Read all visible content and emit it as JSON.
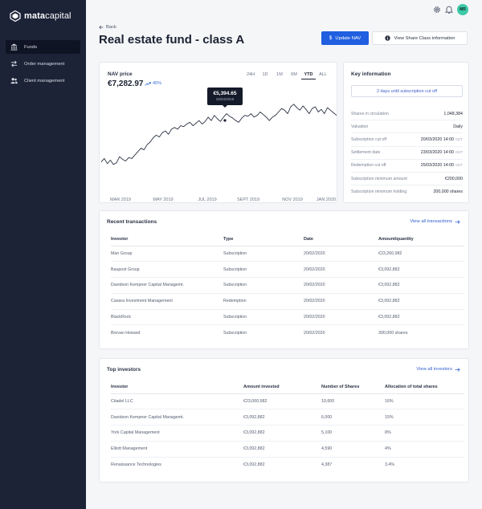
{
  "app": {
    "logo_bold": "mata",
    "logo_light": "capital"
  },
  "sidebar": {
    "items": [
      {
        "label": "Funds",
        "icon": "bank-icon",
        "active": true
      },
      {
        "label": "Order management",
        "icon": "transfer-icon",
        "active": false
      },
      {
        "label": "Client management",
        "icon": "users-icon",
        "active": false
      }
    ]
  },
  "topbar": {
    "icons": [
      "settings-icon",
      "bell-icon"
    ],
    "avatar_initials": "MR"
  },
  "header": {
    "back_label": "Back",
    "title": "Real estate fund - class A",
    "update_nav_label": "Update NAV",
    "view_info_label": "View Share Class information"
  },
  "nav_chart": {
    "label": "NAV price",
    "value": "€7,282.97",
    "change": "45%",
    "ranges": [
      "24H",
      "1D",
      "1M",
      "6M",
      "YTD",
      "ALL"
    ],
    "active_range": "YTD",
    "tooltip_value": "€5,394.65",
    "tooltip_date": "15/04/2019"
  },
  "chart_data": {
    "type": "line",
    "title": "NAV price",
    "x_ticks": [
      "MAR 2019",
      "MAY 2019",
      "JUL 2019",
      "SEPT 2019",
      "NOV 2019",
      "JAN 2020"
    ],
    "values": [
      32,
      36,
      30,
      34,
      29,
      31,
      38,
      35,
      33,
      37,
      36,
      40,
      44,
      48,
      46,
      52,
      55,
      60,
      63,
      61,
      66,
      68,
      64,
      70,
      72,
      70,
      74,
      73,
      76,
      78,
      74,
      77,
      80,
      76,
      79,
      84,
      80,
      86,
      82,
      79,
      84,
      88,
      85,
      83,
      80,
      78,
      83,
      86,
      85,
      88,
      84,
      86,
      90,
      87,
      84,
      80,
      84,
      86,
      90,
      94,
      92,
      88,
      96,
      99,
      95,
      92,
      97,
      93,
      88,
      94,
      96,
      90,
      93,
      88,
      95,
      92,
      89,
      86
    ],
    "ylim": [
      0,
      110
    ],
    "grid": false,
    "legend": "none",
    "line_color": "#2b3244"
  },
  "key_info": {
    "title": "Key information",
    "pill": "2 days until subscription cut off",
    "rows": [
      {
        "label": "Shares in circulation",
        "value": "1,048,384",
        "tz": ""
      },
      {
        "label": "Valuation",
        "value": "Daily",
        "tz": ""
      },
      {
        "label": "Subscription cut off",
        "value": "20/03/2020 14:00",
        "tz": "CET"
      },
      {
        "label": "Settlement date",
        "value": "23/03/2020 14:00",
        "tz": "CET"
      },
      {
        "label": "Redemption cut off",
        "value": "25/03/2020 14:00",
        "tz": "CET"
      },
      {
        "label": "Subscription minimum amount",
        "value": "€200,000",
        "tz": ""
      },
      {
        "label": "Subscription minimum holding",
        "value": "200,000 shares",
        "tz": ""
      }
    ]
  },
  "transactions": {
    "title": "Recent transactions",
    "link": "View all transactions",
    "columns": [
      "Investor",
      "Type",
      "Date",
      "Amount/quantity"
    ],
    "rows": [
      [
        "Man Group",
        "Subscription",
        "20/02/2020",
        "€23,260,982"
      ],
      [
        "Baupost Group",
        "Subscription",
        "20/02/2020",
        "€3,092,882"
      ],
      [
        "Davidson Kempner Capital Managemt.",
        "Subscription",
        "20/02/2020",
        "€3,092,882"
      ],
      [
        "Caxara Investment Management",
        "Redemption",
        "20/02/2020",
        "€3,092,882"
      ],
      [
        "BlackRock",
        "Subscription",
        "20/02/2020",
        "€3,092,882"
      ],
      [
        "Brevan Howard",
        "Subscription",
        "20/02/2020",
        "300,000 shares"
      ]
    ]
  },
  "top_investors": {
    "title": "Top investors",
    "link": "View all investors",
    "columns": [
      "Investor",
      "Amount invested",
      "Number of Shares",
      "Allocation of total shares"
    ],
    "rows": [
      [
        "Citadel LLC",
        "€23,060,982",
        "10,600",
        "16%"
      ],
      [
        "Davidson Kempner Capital Managemt.",
        "€3,092,882",
        "6,000",
        "15%"
      ],
      [
        "York Capital Management",
        "€3,092,882",
        "5,100",
        "8%"
      ],
      [
        "Elliott Management",
        "€3,092,882",
        "4,590",
        "4%"
      ],
      [
        "Renaissance Technologies",
        "€3,092,882",
        "4,387",
        "3.4%"
      ]
    ]
  },
  "colors": {
    "sidebar_bg": "#1c2337",
    "primary": "#1f5fe0",
    "avatar": "#3ec9a8",
    "link": "#2f5ecf"
  }
}
